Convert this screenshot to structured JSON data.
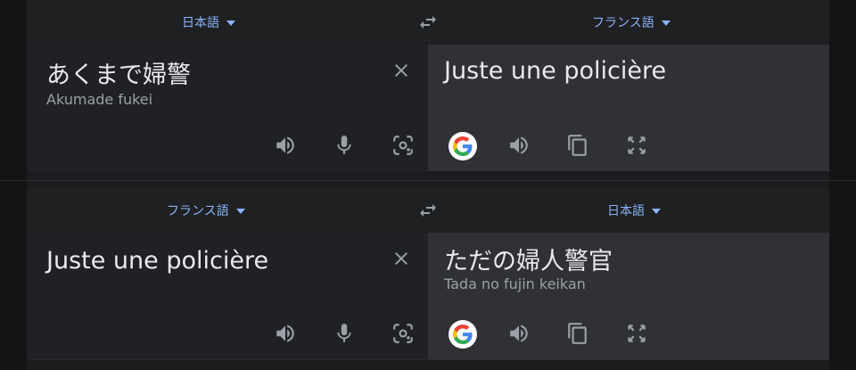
{
  "colors": {
    "accent": "#8ab4f8",
    "source_bg": "#202124",
    "target_bg": "#303134",
    "icon": "#9aa0a6"
  },
  "card1": {
    "source_lang": "日本語",
    "target_lang": "フランス語",
    "source_text": "あくまで婦警",
    "source_romanization": "Akumade fukei",
    "target_text": "Juste une policière"
  },
  "card2": {
    "source_lang": "フランス語",
    "target_lang": "日本語",
    "source_text": "Juste une policière",
    "target_text": "ただの婦人警官",
    "target_romanization": "Tada no fujin keikan"
  },
  "icons": {
    "swap": "swap-languages-icon",
    "clear": "close-icon",
    "listen": "speaker-icon",
    "mic": "microphone-icon",
    "camera": "camera-icon",
    "google": "google-logo-icon",
    "copy": "copy-icon",
    "fullscreen": "fullscreen-icon"
  }
}
